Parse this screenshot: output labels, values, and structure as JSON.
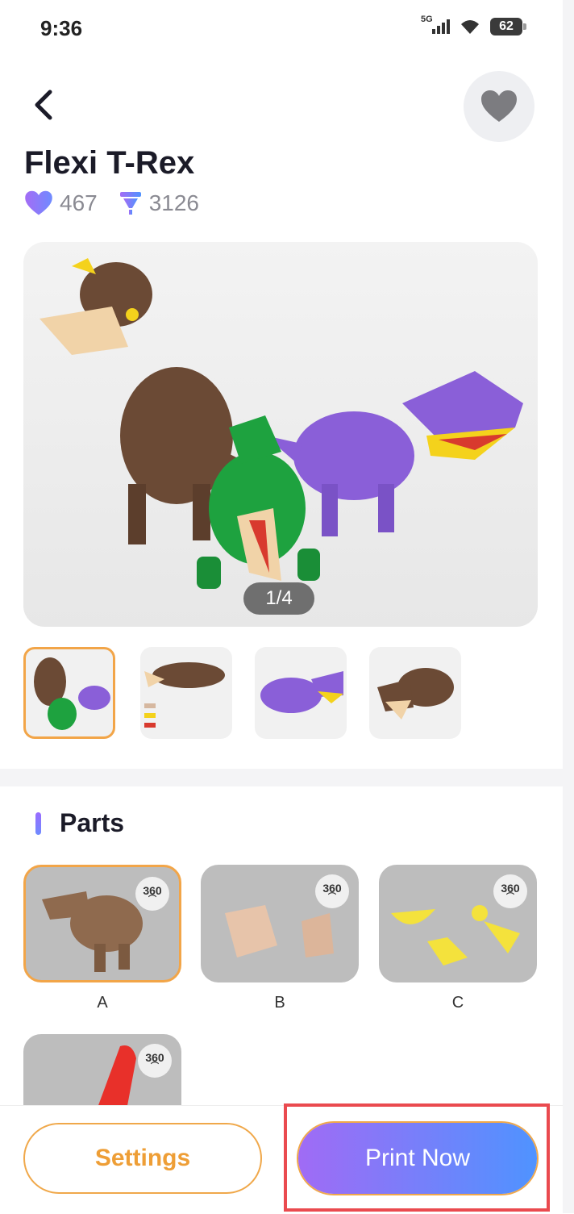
{
  "status_bar": {
    "time": "9:36",
    "network": "5G",
    "battery": "62"
  },
  "header": {
    "back_icon": "chevron-left-icon",
    "favorite_icon": "heart-icon"
  },
  "product": {
    "title": "Flexi T-Rex",
    "likes": "467",
    "prints": "3126",
    "image_counter": "1/4"
  },
  "parts": {
    "title": "Parts",
    "badge": "360",
    "items": [
      {
        "label": "A"
      },
      {
        "label": "B"
      },
      {
        "label": "C"
      },
      {
        "label": ""
      }
    ]
  },
  "actions": {
    "settings_label": "Settings",
    "print_label": "Print Now"
  },
  "colors": {
    "accent_orange": "#f0a84a",
    "gradient_start": "#a06bf5",
    "gradient_end": "#4f93ff",
    "highlight": "#ea4a4f"
  }
}
